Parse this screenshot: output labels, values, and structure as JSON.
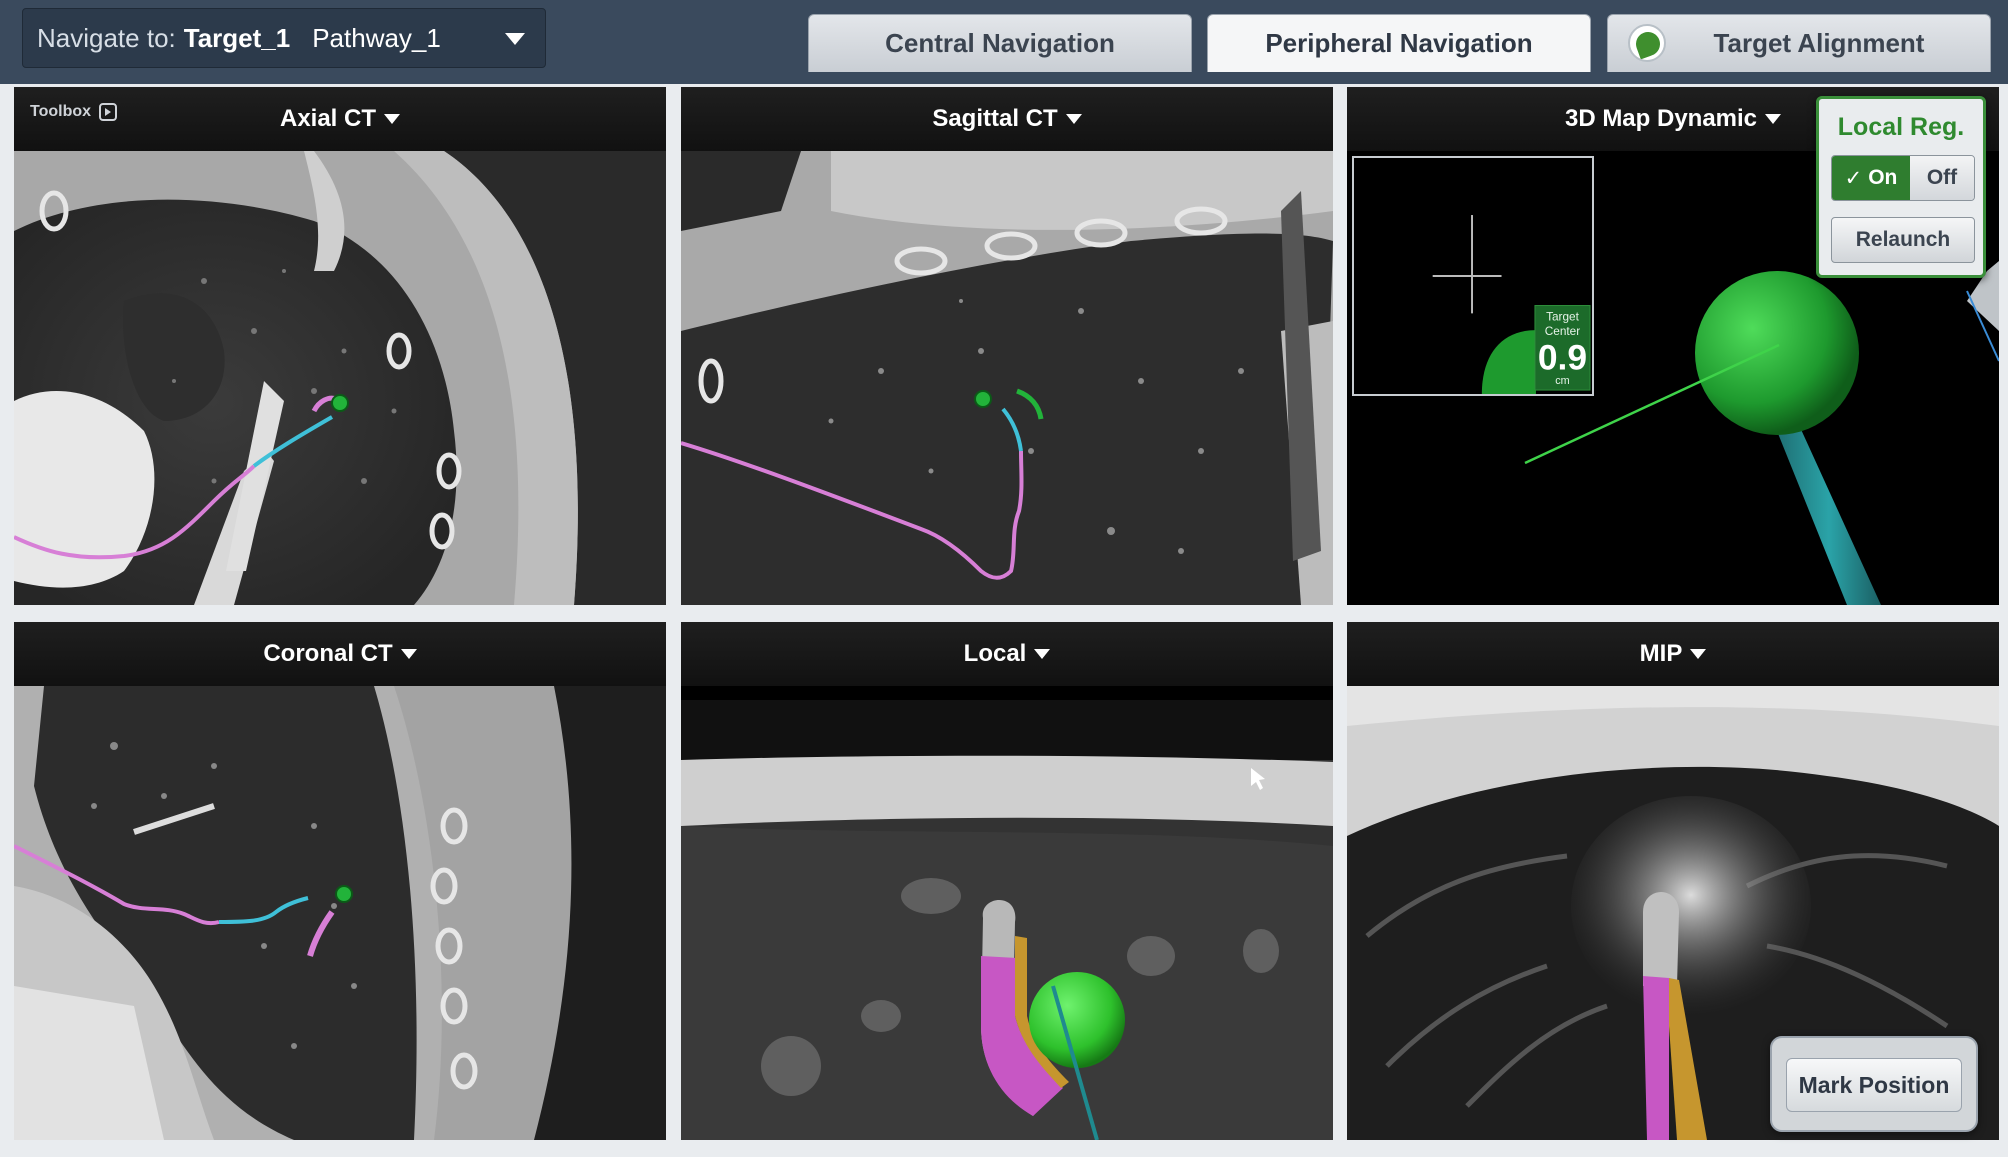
{
  "nav": {
    "label": "Navigate to:",
    "target": "Target_1",
    "pathway": "Pathway_1"
  },
  "tabs": [
    {
      "label": "Central Navigation",
      "active": false
    },
    {
      "label": "Peripheral Navigation",
      "active": true
    },
    {
      "label": "Target Alignment",
      "active": false
    }
  ],
  "toolbox": {
    "label": "Toolbox"
  },
  "panels": {
    "axial": {
      "title": "Axial CT"
    },
    "sagittal": {
      "title": "Sagittal CT"
    },
    "map3d": {
      "title": "3D Map Dynamic"
    },
    "coronal": {
      "title": "Coronal CT"
    },
    "local": {
      "title": "Local"
    },
    "mip": {
      "title": "MIP"
    }
  },
  "target_center": {
    "label_line1": "Target",
    "label_line2": "Center",
    "value": "0.9",
    "unit": "cm"
  },
  "local_reg": {
    "title": "Local Reg.",
    "on_label": "On",
    "off_label": "Off",
    "relaunch_label": "Relaunch",
    "state": "On"
  },
  "mark_position": {
    "label": "Mark Position"
  },
  "colors": {
    "pathway_pink": "#d77fd6",
    "catheter_cyan": "#3fc0d8",
    "target_green": "#22b33a",
    "active_green": "#2f7d2f"
  }
}
